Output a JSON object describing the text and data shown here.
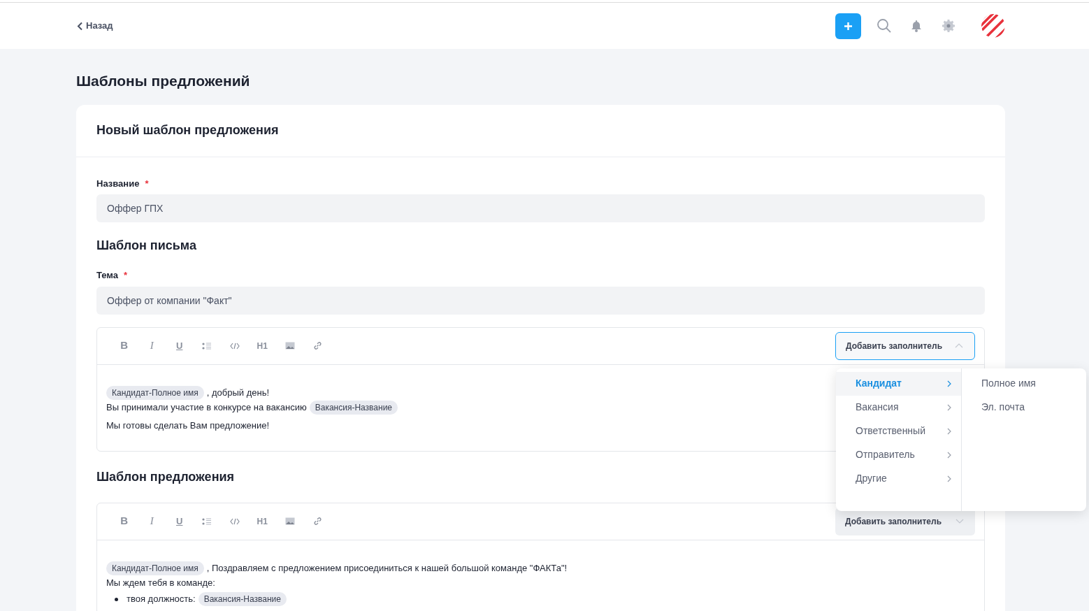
{
  "header": {
    "back_label": "Назад"
  },
  "page_title": "Шаблоны предложений",
  "card": {
    "title": "Новый шаблон предложения",
    "name_field": {
      "label": "Название",
      "required_mark": "*",
      "value": "Оффер ГПХ"
    },
    "letter_section": "Шаблон письма",
    "subject_field": {
      "label": "Тема",
      "required_mark": "*",
      "value": "Оффер от компании \"Факт\""
    },
    "editors": [
      {
        "toolbar": [
          {
            "kind": "bold",
            "label": "B"
          },
          {
            "kind": "italic",
            "label": "I"
          },
          {
            "kind": "underline",
            "label": "U"
          },
          {
            "kind": "list"
          },
          {
            "kind": "code"
          },
          {
            "kind": "heading",
            "label": "H1"
          },
          {
            "kind": "image"
          },
          {
            "kind": "link"
          }
        ],
        "placeholder_button": {
          "label": "Добавить заполнитель",
          "expanded": true
        },
        "content": [
          {
            "kind": "line",
            "segments": [
              {
                "kind": "chip",
                "text": "Кандидат-Полное имя"
              },
              {
                "kind": "text",
                "text": ", добрый день!"
              }
            ]
          },
          {
            "kind": "line",
            "segments": [
              {
                "kind": "text",
                "text": "Вы принимали участие в конкурсе на вакансию"
              },
              {
                "kind": "chip",
                "text": "Вакансия-Название"
              }
            ]
          },
          {
            "kind": "line",
            "segments": [
              {
                "kind": "text",
                "text": "Мы готовы сделать Вам предложение!"
              }
            ]
          }
        ]
      },
      {
        "section_title": "Шаблон предложения",
        "toolbar": [
          {
            "kind": "bold",
            "label": "B"
          },
          {
            "kind": "italic",
            "label": "I"
          },
          {
            "kind": "underline",
            "label": "U"
          },
          {
            "kind": "list"
          },
          {
            "kind": "code"
          },
          {
            "kind": "heading",
            "label": "H1"
          },
          {
            "kind": "image"
          },
          {
            "kind": "link"
          }
        ],
        "placeholder_button": {
          "label": "Добавить заполнитель",
          "expanded": false
        },
        "content": [
          {
            "kind": "line",
            "segments": [
              {
                "kind": "chip",
                "text": "Кандидат-Полное имя"
              },
              {
                "kind": "text",
                "text": ", Поздравляем с предложением присоединиться к нашей большой команде \"ФАКТа\"!"
              }
            ]
          },
          {
            "kind": "line",
            "segments": [
              {
                "kind": "text",
                "text": "Мы ждем тебя в команде:"
              }
            ]
          },
          {
            "kind": "bullet",
            "segments": [
              {
                "kind": "text",
                "text": "твоя должность:"
              },
              {
                "kind": "chip",
                "text": "Вакансия-Название"
              }
            ]
          }
        ]
      }
    ]
  },
  "placeholder_menu": {
    "categories": [
      {
        "label": "Кандидат",
        "selected": true
      },
      {
        "label": "Вакансия",
        "selected": false
      },
      {
        "label": "Ответственный",
        "selected": false
      },
      {
        "label": "Отправитель",
        "selected": false
      },
      {
        "label": "Другие",
        "selected": false
      }
    ],
    "submenu": [
      "Полное имя",
      "Эл. почта"
    ]
  }
}
